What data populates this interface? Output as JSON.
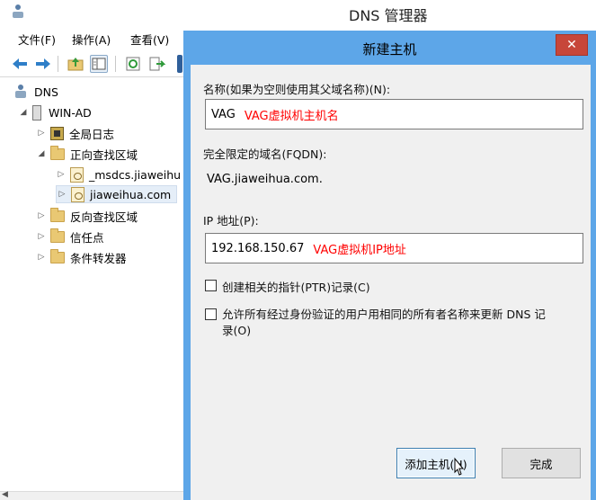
{
  "main_window": {
    "title": "DNS 管理器",
    "menu": [
      "文件(F)",
      "操作(A)",
      "查看(V)"
    ],
    "toolbar_icons": [
      "back-arrow-icon",
      "forward-arrow-icon",
      "up-folder-icon",
      "show-hide-tree-icon",
      "refresh-icon",
      "export-list-icon"
    ]
  },
  "tree": {
    "root": "DNS",
    "server": "WIN-AD",
    "items": [
      {
        "label": "全局日志",
        "expander": "▷"
      },
      {
        "label": "正向查找区域",
        "expander": "◢"
      },
      {
        "label": "_msdcs.jiaweihu",
        "expander": "▷"
      },
      {
        "label": "jiaweihua.com",
        "expander": "▷"
      },
      {
        "label": "反向查找区域",
        "expander": "▷"
      },
      {
        "label": "信任点",
        "expander": "▷"
      },
      {
        "label": "条件转发器",
        "expander": "▷"
      }
    ],
    "root_expander": "",
    "server_expander": "◢"
  },
  "dialog": {
    "title": "新建主机",
    "close": "✕",
    "name_label": "名称(如果为空则使用其父域名称)(N):",
    "name_value": "VAG",
    "name_annotation": "VAG虚拟机主机名",
    "fqdn_label": "完全限定的域名(FQDN):",
    "fqdn_value": "VAG.jiaweihua.com.",
    "ip_label": "IP 地址(P):",
    "ip_value": "192.168.150.67",
    "ip_annotation": "VAG虚拟机IP地址",
    "ptr_checkbox": "创建相关的指针(PTR)记录(C)",
    "allow_update_line1": "允许所有经过身份验证的用户用相同的所有者名称来更新 DNS 记",
    "allow_update_line2": "录(O)",
    "add_host_button": "添加主机(H)",
    "done_button": "完成"
  },
  "colors": {
    "dialog_frame": "#5da6e8",
    "close_button": "#c7463a",
    "annotation": "#ff0000"
  }
}
